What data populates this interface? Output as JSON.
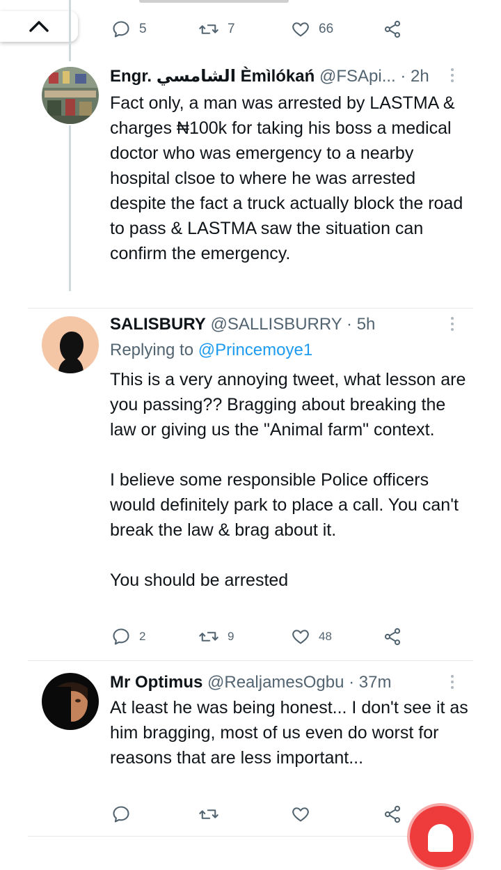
{
  "colors": {
    "accent": "#1d9bf0",
    "muted": "#536471",
    "text": "#0f1419",
    "fab": "#ee3b3b"
  },
  "top_action_bar": {
    "replies": "5",
    "retweets": "7",
    "likes": "66"
  },
  "tweets": [
    {
      "name": "Engr. الشامسي Èmìlókań",
      "handle": "@FSApi...",
      "time": "· 2h",
      "body": "Fact only, a man was arrested by LASTMA & charges ₦100k for taking his boss a medical doctor who was emergency to a nearby hospital clsoe to where he was arrested despite the fact a truck actually block the road to pass & LASTMA saw the situation can confirm the emergency."
    },
    {
      "name": "SALISBURY",
      "handle": "@SALLISBURRY",
      "time": "· 5h",
      "replying_label": "Replying to",
      "replying_to": "@Princemoye1",
      "body": "This is a very annoying tweet, what lesson are you passing?? Bragging about breaking the law or giving us the \"Animal farm\" context.\n\nI believe some responsible Police officers would definitely park to place a call. You can't break the law & brag about it.\n\nYou should be arrested",
      "replies": "2",
      "retweets": "9",
      "likes": "48"
    },
    {
      "name": "Mr Optimus",
      "handle": "@RealjamesOgbu",
      "time": "· 37m",
      "body": "At least he was being honest... I don't see it as him bragging, most of us even do worst for reasons that are less important...",
      "replies": "",
      "retweets": "",
      "likes": ""
    }
  ],
  "icons": {
    "reply": "reply-icon",
    "retweet": "retweet-icon",
    "like": "heart-icon",
    "share": "share-icon",
    "more": "more-icon",
    "scroll_up": "chevron-up-icon"
  }
}
